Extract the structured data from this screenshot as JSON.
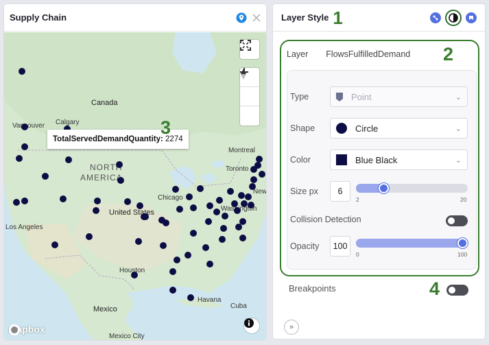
{
  "map_panel": {
    "title": "Supply Chain",
    "tooltip": {
      "field": "TotalServedDemandQuantity:",
      "value": "2274"
    },
    "annotation": "3",
    "attribution": "mapbox",
    "labels": {
      "canada": "Canada",
      "vancouver": "Vancouver",
      "calgary": "Calgary",
      "north_america_1": "NORTH",
      "north_america_2": "AMERICA",
      "montreal": "Montreal",
      "toronto": "Toronto",
      "new_york": "New",
      "chicago": "Chicago",
      "washington": "Washington",
      "united_states": "United States",
      "los_angeles": "Los Angeles",
      "houston": "Houston",
      "mexico": "Mexico",
      "havana": "Havana",
      "cuba": "Cuba",
      "mexico_city": "Mexico City"
    },
    "colors": {
      "point": "#0d0d45",
      "accent": "#1e88e5"
    }
  },
  "style_panel": {
    "title": "Layer Style",
    "annotations": {
      "a1": "1",
      "a2": "2",
      "a4": "4"
    },
    "layer_label": "Layer",
    "layer_name": "FlowsFulfilledDemand",
    "type": {
      "label": "Type",
      "value": "Point"
    },
    "shape": {
      "label": "Shape",
      "value": "Circle"
    },
    "color": {
      "label": "Color",
      "value": "Blue Black",
      "hex": "#0d0d45"
    },
    "size": {
      "label": "Size px",
      "value": "6",
      "min": "2",
      "max": "20",
      "level": 0.22
    },
    "collision": {
      "label": "Collision Detection",
      "enabled": false
    },
    "opacity": {
      "label": "Opacity",
      "value": "100",
      "min": "0",
      "max": "100",
      "level": 1.0
    },
    "breakpoints": {
      "label": "Breakpoints",
      "enabled": false
    }
  }
}
